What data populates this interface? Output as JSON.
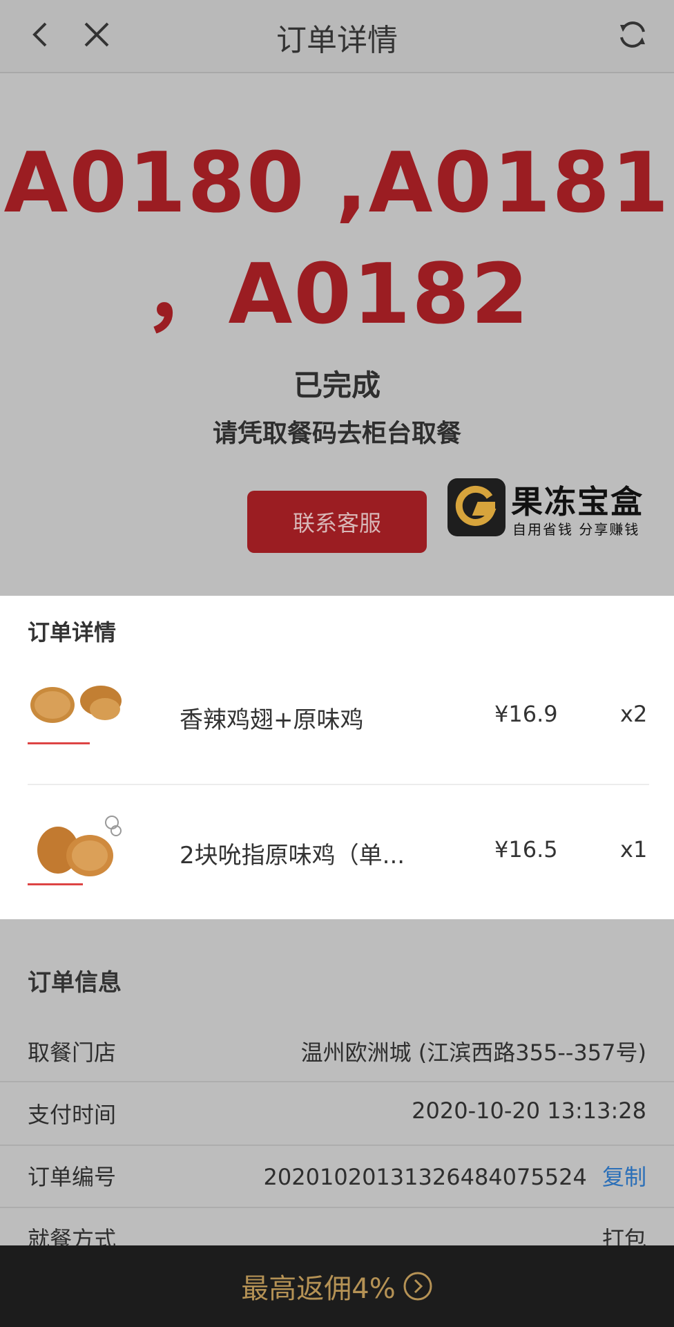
{
  "header": {
    "title": "订单详情",
    "back_icon": "chevron-left-icon",
    "close_icon": "close-icon",
    "refresh_icon": "refresh-icon"
  },
  "hero": {
    "pickup_line1": "A0180 ,A0181",
    "pickup_line2": "，A0182",
    "status": "已完成",
    "hint": "请凭取餐码去柜台取餐",
    "contact_button": "联系客服"
  },
  "watermark": {
    "title": "果冻宝盒",
    "subtitle": "自用省钱  分享赚钱"
  },
  "items_section": {
    "title": "订单详情",
    "items": [
      {
        "name": "香辣鸡翅+原味鸡",
        "price": "¥16.9",
        "qty": "x2"
      },
      {
        "name": "2块吮指原味鸡（单...",
        "price": "¥16.5",
        "qty": "x1"
      }
    ]
  },
  "info_section": {
    "title": "订单信息",
    "rows": [
      {
        "label": "取餐门店",
        "value": "温州欧洲城 (江滨西路355--357号)"
      },
      {
        "label": "支付时间",
        "value": "2020-10-20 13:13:28"
      },
      {
        "label": "订单编号",
        "value": "20201020131326484075524",
        "action": "复制"
      },
      {
        "label": "就餐方式",
        "value": "打包"
      }
    ]
  },
  "bottom_bar": {
    "label": "最高返佣4%",
    "icon": "arrow-right-circle-icon"
  },
  "colors": {
    "accent_red": "#9b1d22",
    "gold": "#b59255",
    "link_blue": "#2b6fb8"
  }
}
